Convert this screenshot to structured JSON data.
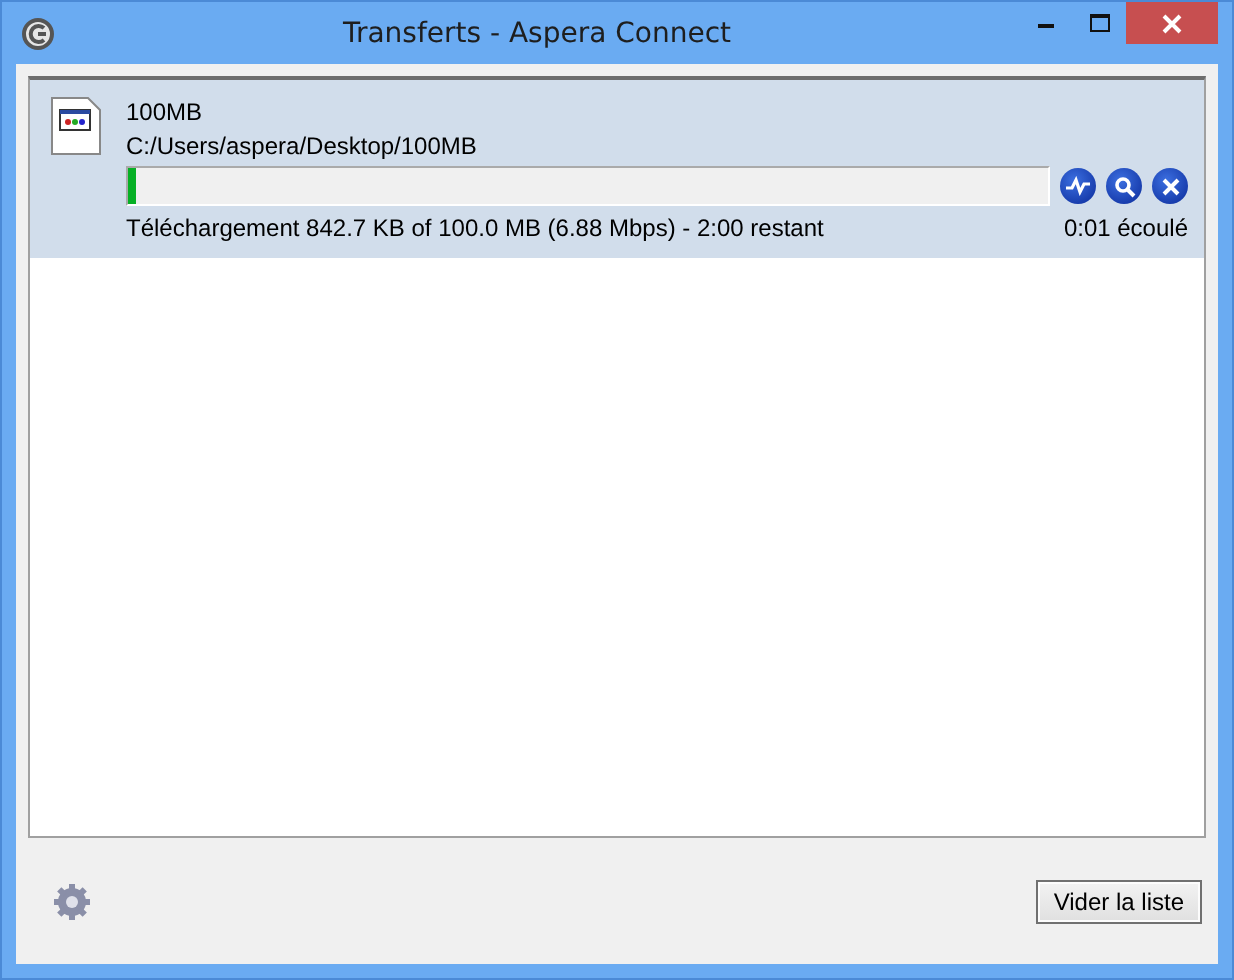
{
  "window": {
    "title": "Transferts - Aspera Connect"
  },
  "transfers": [
    {
      "name": "100MB",
      "path": "C:/Users/aspera/Desktop/100MB",
      "level": 0.008,
      "selected": true,
      "status": "Téléchargement 842.7 KB of 100.0 MB (6.88 Mbps) - 2:00 restant",
      "elapsed": "0:01 écoulé"
    }
  ],
  "footer": {
    "button": "Vider la liste"
  }
}
